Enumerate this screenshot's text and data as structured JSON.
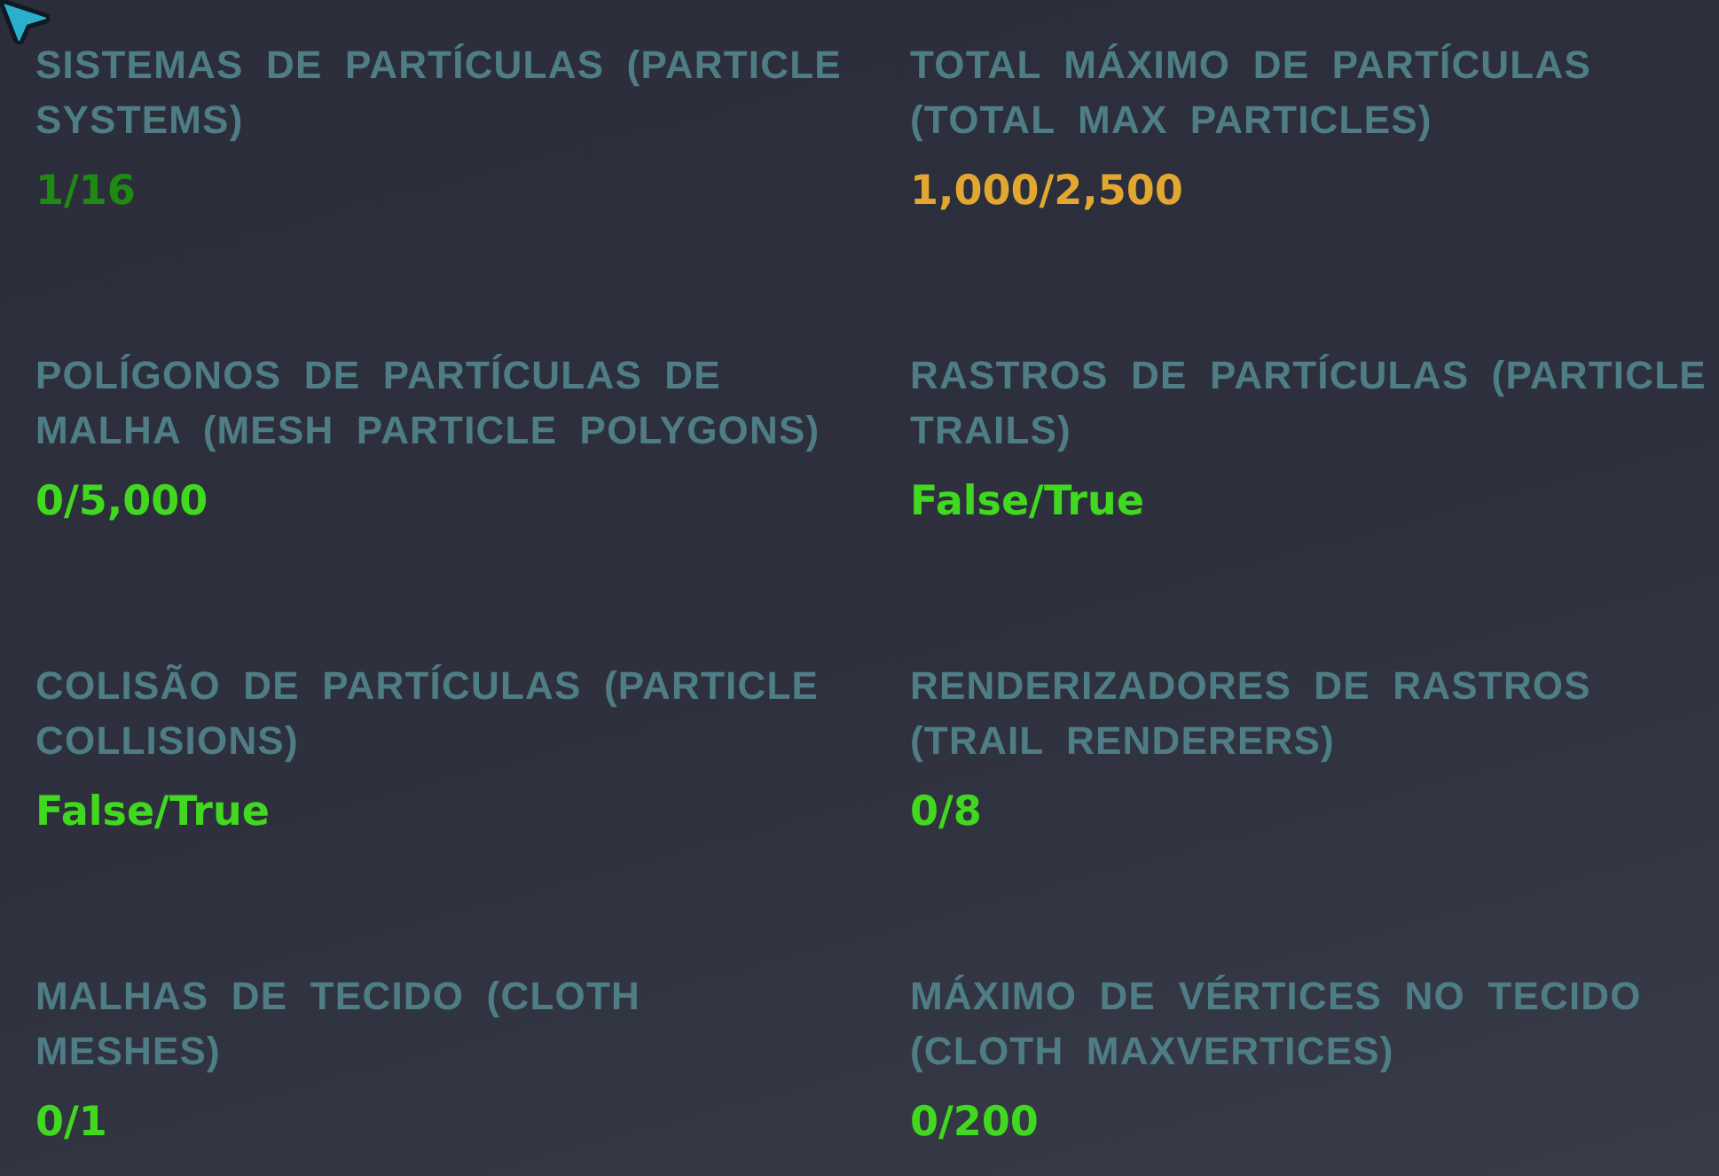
{
  "stats": [
    {
      "label": "SISTEMAS DE PARTÍCULAS (PARTICLE SYSTEMS)",
      "value": "1/16",
      "color": "#1f8a12"
    },
    {
      "label": "TOTAL MÁXIMO DE PARTÍCULAS (TOTAL MAX PARTICLES)",
      "value": "1,000/2,500",
      "color": "#e2a730"
    },
    {
      "label": "POLÍGONOS DE PARTÍCULAS DE MALHA (MESH PARTICLE POLYGONS)",
      "value": "0/5,000",
      "color": "#41d91f"
    },
    {
      "label": "RASTROS DE PARTÍCULAS (PARTICLE TRAILS)",
      "value": "False/True",
      "color": "#41d91f"
    },
    {
      "label": "COLISÃO DE PARTÍCULAS (PARTICLE COLLISIONS)",
      "value": "False/True",
      "color": "#41d91f"
    },
    {
      "label": "RENDERIZADORES DE RASTROS (TRAIL RENDERERS)",
      "value": "0/8",
      "color": "#41d91f"
    },
    {
      "label": "MALHAS DE TECIDO (CLOTH MESHES)",
      "value": "0/1",
      "color": "#41d91f"
    },
    {
      "label": "MÁXIMO DE VÉRTICES NO TECIDO (CLOTH MAXVERTICES)",
      "value": "0/200",
      "color": "#41d91f"
    }
  ]
}
